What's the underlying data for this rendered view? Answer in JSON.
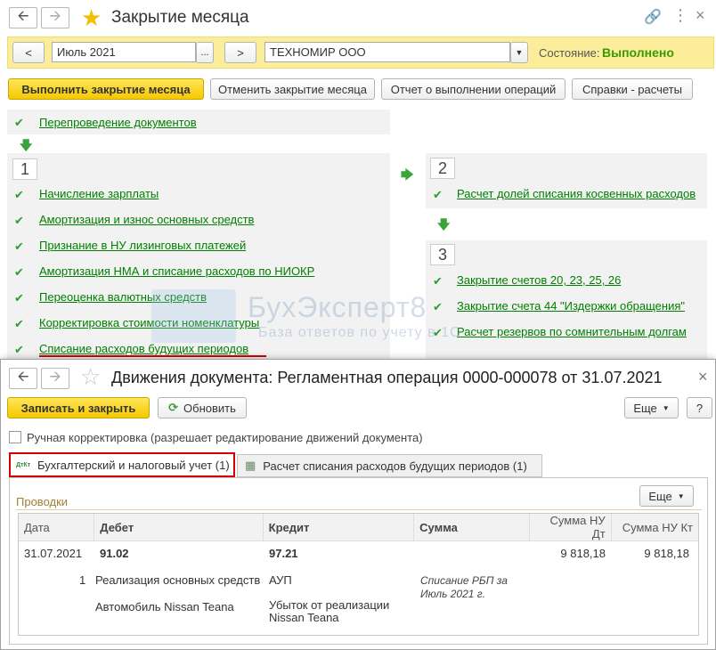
{
  "window": {
    "title": "Закрытие месяца",
    "period": "Июль 2021",
    "period_picker": "...",
    "prev": "<",
    "next": ">",
    "organization": "ТЕХНОМИР ООО",
    "state_label": "Состояние:",
    "state_value": "Выполнено"
  },
  "toolbar": {
    "run": "Выполнить закрытие месяца",
    "cancel": "Отменить закрытие месяца",
    "report": "Отчет о выполнении операций",
    "help": "Справки - расчеты"
  },
  "pre_step": "Перепроведение документов",
  "step1": {
    "num": "1",
    "items": [
      "Начисление зарплаты",
      "Амортизация и износ основных средств",
      "Признание в НУ лизинговых платежей",
      "Амортизация НМА и списание расходов по НИОКР",
      "Переоценка валютных средств",
      "Корректировка стоимости номенклатуры",
      "Списание расходов будущих периодов"
    ]
  },
  "step2": {
    "num": "2",
    "items": [
      "Расчет долей списания косвенных расходов"
    ]
  },
  "step3": {
    "num": "3",
    "items": [
      "Закрытие счетов 20, 23, 25, 26",
      "Закрытие счета 44 \"Издержки обращения\"",
      "Расчет резервов по сомнительным долгам"
    ]
  },
  "watermark": {
    "title": "БухЭксперт8",
    "subtitle": "База ответов по учету в 1С"
  },
  "dialog": {
    "title": "Движения документа: Регламентная операция 0000-000078 от 31.07.2021",
    "save_close": "Записать и закрыть",
    "refresh": "Обновить",
    "more": "Еще",
    "help": "?",
    "close": "×",
    "manual_edit": "Ручная корректировка (разрешает редактирование движений документа)",
    "tabs": [
      {
        "label": "Бухгалтерский и налоговый учет (1)",
        "icon_text": "ДтКт"
      },
      {
        "label": "Расчет списания расходов будущих периодов (1)"
      }
    ],
    "section_title": "Проводки",
    "table_more": "Еще",
    "columns": [
      "Дата",
      "Дебет",
      "Кредит",
      "Сумма",
      "Сумма НУ Дт",
      "Сумма НУ Кт"
    ],
    "row": {
      "date": "31.07.2021",
      "debit": "91.02",
      "credit": "97.21",
      "sum_nu_dt": "9 818,18",
      "sum_nu_kt": "9 818,18",
      "num": "1",
      "debit_sub1": "Реализация основных средств",
      "debit_sub2": "Автомобиль Nissan Teana",
      "credit_sub1": "АУП",
      "credit_sub2": "Убыток от реализации",
      "credit_sub3": "Nissan Teana",
      "content": "Списание РБП за Июль 2021 г."
    }
  },
  "colors": {
    "accent_yellow": "#f5c900",
    "link_green": "#008000",
    "highlight_red": "#d40000",
    "state_green": "#3a9a00"
  }
}
